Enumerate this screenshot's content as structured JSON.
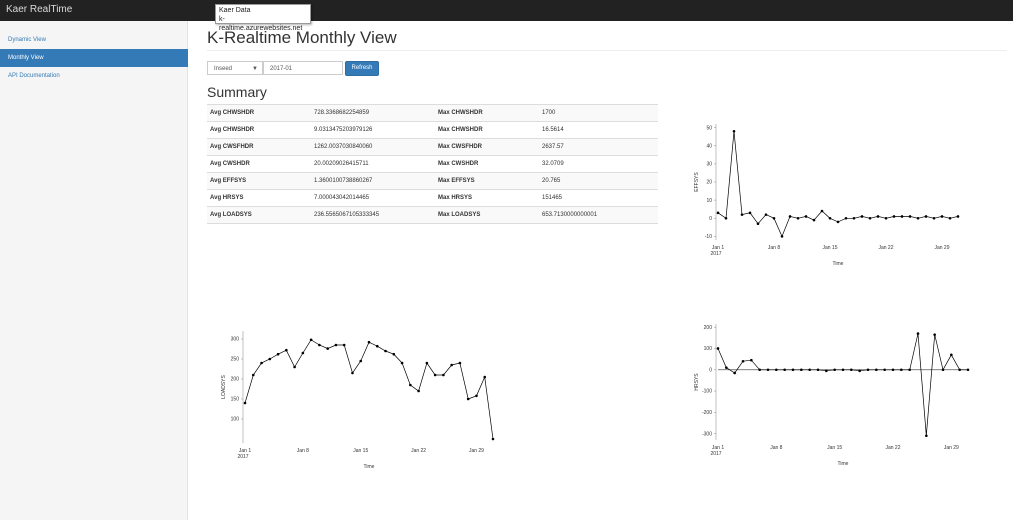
{
  "app": {
    "brand": "Kaer RealTime"
  },
  "tooltip": {
    "line1": "Kaer Data",
    "line2": "k-realtime.azurewebsites.net"
  },
  "sidebar": {
    "items": [
      {
        "label": "Dynamic View",
        "active": false
      },
      {
        "label": "Monthly View",
        "active": true
      },
      {
        "label": "API Documentation",
        "active": false
      }
    ]
  },
  "page": {
    "title": "K-Realtime Monthly View"
  },
  "controls": {
    "select_value": "Inseed",
    "month_value": "2017-01",
    "refresh_label": "Refresh"
  },
  "summary": {
    "heading": "Summary",
    "rows": [
      {
        "avg_label": "Avg CHWSHDR",
        "avg_value": "728.3368682254859",
        "max_label": "Max CHWSHDR",
        "max_value": "1700"
      },
      {
        "avg_label": "Avg CHWSHDR",
        "avg_value": "9.0313475203979126",
        "max_label": "Max CHWSHDR",
        "max_value": "16.5614"
      },
      {
        "avg_label": "Avg CWSFHDR",
        "avg_value": "1262.0037030840060",
        "max_label": "Max CWSFHDR",
        "max_value": "2637.57"
      },
      {
        "avg_label": "Avg CWSHDR",
        "avg_value": "20.00209026415711",
        "max_label": "Max CWSHDR",
        "max_value": "32.0709"
      },
      {
        "avg_label": "Avg EFFSYS",
        "avg_value": "1.3600100738860267",
        "max_label": "Max EFFSYS",
        "max_value": "20.765"
      },
      {
        "avg_label": "Avg HRSYS",
        "avg_value": "7.000043042014465",
        "max_label": "Max HRSYS",
        "max_value": "151465"
      },
      {
        "avg_label": "Avg LOADSYS",
        "avg_value": "236.5565067105333345",
        "max_label": "Max LOADSYS",
        "max_value": "653.7130000000001"
      }
    ]
  },
  "chart_data": [
    {
      "id": "effsys",
      "type": "line",
      "xlabel": "Time",
      "ylabel": "EFFSYS",
      "xlim": [
        0,
        30
      ],
      "ylim": [
        -12,
        52
      ],
      "yticks": [
        -10,
        0,
        10,
        20,
        30,
        40,
        50
      ],
      "xticks": [
        {
          "x": 0,
          "label": "Jan 1",
          "sub": "2017"
        },
        {
          "x": 7,
          "label": "Jan 8"
        },
        {
          "x": 14,
          "label": "Jan 15"
        },
        {
          "x": 21,
          "label": "Jan 22"
        },
        {
          "x": 28,
          "label": "Jan 29"
        }
      ],
      "x": [
        0,
        1,
        2,
        3,
        4,
        5,
        6,
        7,
        8,
        9,
        10,
        11,
        12,
        13,
        14,
        15,
        16,
        17,
        18,
        19,
        20,
        21,
        22,
        23,
        24,
        25,
        26,
        27,
        28,
        29,
        30
      ],
      "values": [
        3,
        0,
        48,
        2,
        3,
        -3,
        2,
        0,
        -10,
        1,
        0,
        1,
        -1,
        4,
        0,
        -2,
        0,
        0,
        1,
        0,
        1,
        0,
        1,
        1,
        1,
        0,
        1,
        0,
        1,
        0,
        1
      ]
    },
    {
      "id": "loadsys",
      "type": "line",
      "xlabel": "Time",
      "ylabel": "LOADSYS",
      "xlim": [
        0,
        30
      ],
      "ylim": [
        40,
        320
      ],
      "yticks": [
        100,
        150,
        200,
        250,
        300
      ],
      "xticks": [
        {
          "x": 0,
          "label": "Jan 1",
          "sub": "2017"
        },
        {
          "x": 7,
          "label": "Jan 8"
        },
        {
          "x": 14,
          "label": "Jan 15"
        },
        {
          "x": 21,
          "label": "Jan 22"
        },
        {
          "x": 28,
          "label": "Jan 29"
        }
      ],
      "x": [
        0,
        1,
        2,
        3,
        4,
        5,
        6,
        7,
        8,
        9,
        10,
        11,
        12,
        13,
        14,
        15,
        16,
        17,
        18,
        19,
        20,
        21,
        22,
        23,
        24,
        25,
        26,
        27,
        28,
        29,
        30
      ],
      "values": [
        140,
        210,
        240,
        250,
        262,
        272,
        230,
        265,
        298,
        285,
        276,
        285,
        285,
        215,
        245,
        292,
        282,
        270,
        262,
        240,
        185,
        170,
        240,
        210,
        210,
        235,
        240,
        150,
        158,
        205,
        50
      ]
    },
    {
      "id": "hrsys",
      "type": "line",
      "xlabel": "Time",
      "ylabel": "HRSYS",
      "xlim": [
        0,
        30
      ],
      "ylim": [
        -330,
        215
      ],
      "yticks": [
        -300,
        -200,
        -100,
        0,
        100,
        200
      ],
      "xticks": [
        {
          "x": 0,
          "label": "Jan 1",
          "sub": "2017"
        },
        {
          "x": 7,
          "label": "Jan 8"
        },
        {
          "x": 14,
          "label": "Jan 15"
        },
        {
          "x": 21,
          "label": "Jan 22"
        },
        {
          "x": 28,
          "label": "Jan 29"
        }
      ],
      "x": [
        0,
        1,
        2,
        3,
        4,
        5,
        6,
        7,
        8,
        9,
        10,
        11,
        12,
        13,
        14,
        15,
        16,
        17,
        18,
        19,
        20,
        21,
        22,
        23,
        24,
        25,
        26,
        27,
        28,
        29,
        30
      ],
      "values": [
        100,
        10,
        -15,
        40,
        45,
        0,
        0,
        0,
        0,
        0,
        0,
        0,
        0,
        -5,
        0,
        0,
        0,
        -5,
        0,
        0,
        0,
        0,
        0,
        0,
        170,
        -310,
        165,
        0,
        70,
        0,
        0
      ]
    }
  ]
}
